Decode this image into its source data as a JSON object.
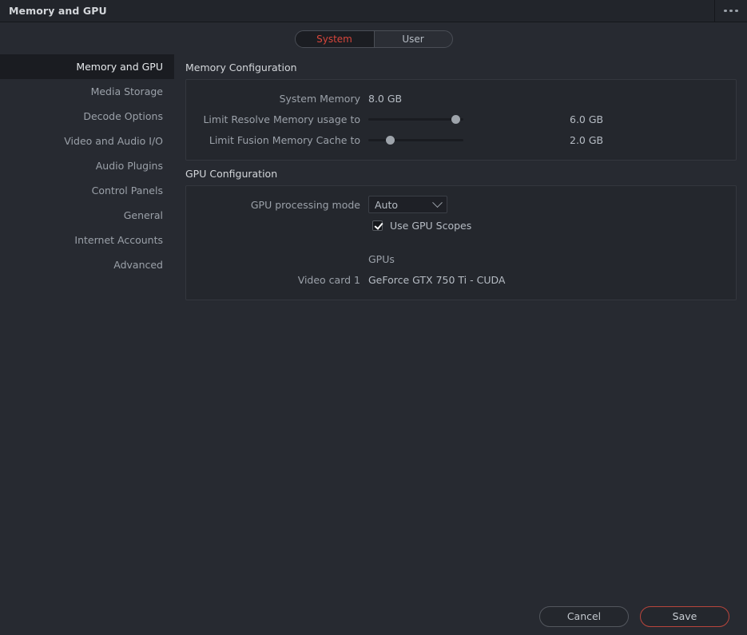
{
  "window": {
    "title": "Memory and GPU",
    "menu_icon": "ellipsis-horizontal-icon"
  },
  "tabs": [
    {
      "label": "System",
      "active": true
    },
    {
      "label": "User",
      "active": false
    }
  ],
  "sidebar": {
    "items": [
      {
        "label": "Memory and GPU",
        "active": true
      },
      {
        "label": "Media Storage",
        "active": false
      },
      {
        "label": "Decode Options",
        "active": false
      },
      {
        "label": "Video and Audio I/O",
        "active": false
      },
      {
        "label": "Audio Plugins",
        "active": false
      },
      {
        "label": "Control Panels",
        "active": false
      },
      {
        "label": "General",
        "active": false
      },
      {
        "label": "Internet Accounts",
        "active": false
      },
      {
        "label": "Advanced",
        "active": false
      }
    ]
  },
  "memory": {
    "section_title": "Memory Configuration",
    "system_memory_label": "System Memory",
    "system_memory_value": "8.0 GB",
    "resolve_label": "Limit Resolve Memory usage to",
    "resolve_value": "6.0 GB",
    "resolve_percent": 96,
    "fusion_label": "Limit Fusion Memory Cache to",
    "fusion_value": "2.0 GB",
    "fusion_percent": 20
  },
  "gpu": {
    "section_title": "GPU Configuration",
    "processing_mode_label": "GPU processing mode",
    "processing_mode_value": "Auto",
    "processing_mode_icon": "chevron-down-icon",
    "use_scopes_label": "Use GPU Scopes",
    "use_scopes_checked": true,
    "gpus_label": "GPUs",
    "video_card_label": "Video card 1",
    "video_card_value": "GeForce GTX 750 Ti - CUDA"
  },
  "footer": {
    "cancel_label": "Cancel",
    "save_label": "Save"
  },
  "colors": {
    "accent_red": "#d8463c",
    "background": "#272a31",
    "panel": "#24272d",
    "text_primary": "#d3d6da",
    "text_muted": "#9ba1a9"
  }
}
